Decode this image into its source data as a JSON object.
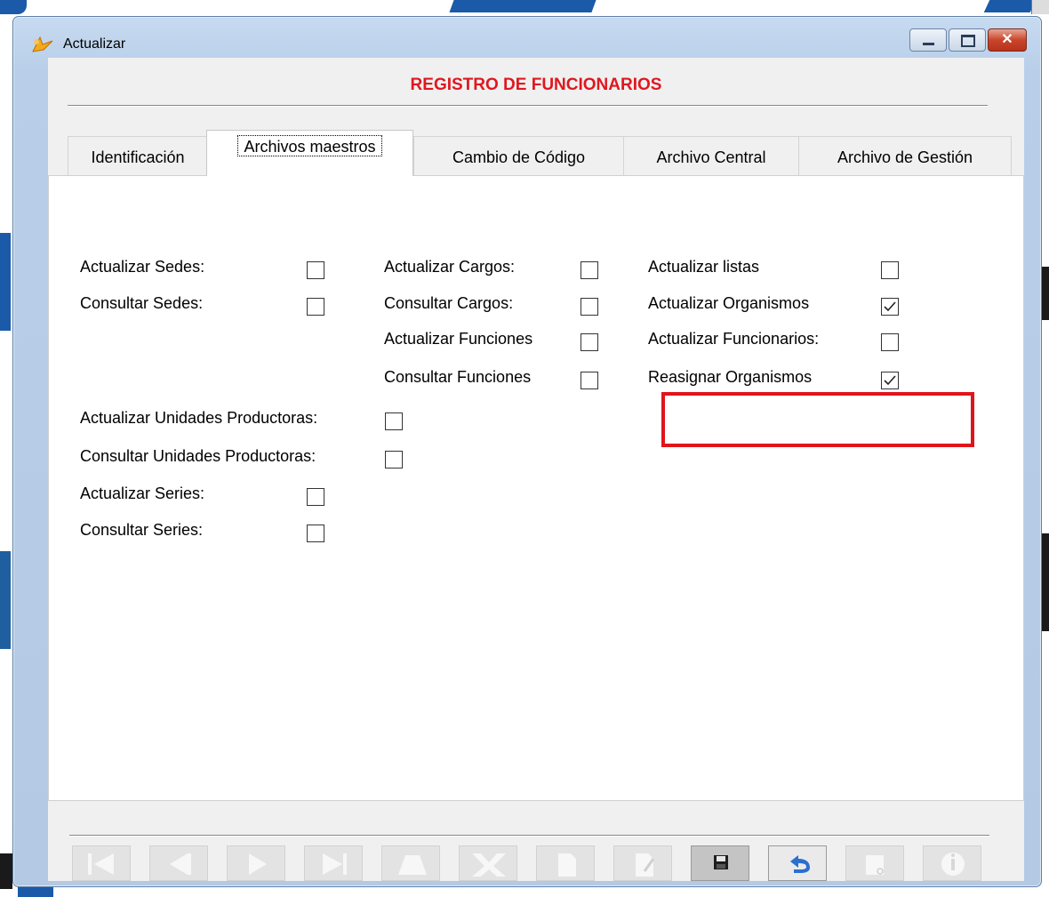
{
  "window": {
    "title": "Actualizar",
    "icon": "app-icon"
  },
  "form": {
    "title": "REGISTRO DE FUNCIONARIOS"
  },
  "tabs": [
    {
      "label": "Identificación",
      "active": false
    },
    {
      "label": "Archivos maestros",
      "active": true
    },
    {
      "label": "Cambio de Código",
      "active": false
    },
    {
      "label": "Archivo Central",
      "active": false
    },
    {
      "label": "Archivo de Gestión",
      "active": false
    }
  ],
  "permissions": {
    "actualizar_sedes": {
      "label": "Actualizar Sedes:",
      "checked": false
    },
    "consultar_sedes": {
      "label": "Consultar Sedes:",
      "checked": false
    },
    "actualizar_cargos": {
      "label": "Actualizar Cargos:",
      "checked": false
    },
    "consultar_cargos": {
      "label": "Consultar Cargos:",
      "checked": false
    },
    "actualizar_funciones": {
      "label": "Actualizar Funciones",
      "checked": false
    },
    "consultar_funciones": {
      "label": "Consultar Funciones",
      "checked": false
    },
    "actualizar_listas": {
      "label": "Actualizar listas",
      "checked": false
    },
    "actualizar_organismos": {
      "label": "Actualizar Organismos",
      "checked": true
    },
    "actualizar_funcionarios": {
      "label": "Actualizar Funcionarios:",
      "checked": false
    },
    "reasignar_organismos": {
      "label": "Reasignar Organismos",
      "checked": true
    },
    "actualizar_unidades_productoras": {
      "label": "Actualizar Unidades Productoras:",
      "checked": false
    },
    "consultar_unidades_productoras": {
      "label": "Consultar Unidades Productoras:",
      "checked": false
    },
    "actualizar_series": {
      "label": "Actualizar Series:",
      "checked": false
    },
    "consultar_series": {
      "label": "Consultar Series:",
      "checked": false
    }
  },
  "highlight": {
    "color": "#e0151b",
    "target": "reasignar_organismos"
  },
  "toolbar": [
    {
      "icon": "first-record-icon",
      "enabled": false
    },
    {
      "icon": "previous-record-icon",
      "enabled": false
    },
    {
      "icon": "next-record-icon",
      "enabled": false
    },
    {
      "icon": "last-record-icon",
      "enabled": false
    },
    {
      "icon": "insert-icon",
      "enabled": false
    },
    {
      "icon": "delete-icon",
      "enabled": false
    },
    {
      "icon": "new-document-icon",
      "enabled": false
    },
    {
      "icon": "edit-document-icon",
      "enabled": false
    },
    {
      "icon": "save-icon",
      "enabled": true
    },
    {
      "icon": "undo-icon",
      "enabled": true
    },
    {
      "icon": "cut-icon",
      "enabled": false
    },
    {
      "icon": "info-icon",
      "enabled": false
    }
  ],
  "colors": {
    "title_red": "#e0171f",
    "undo_blue": "#2a6fd1"
  }
}
